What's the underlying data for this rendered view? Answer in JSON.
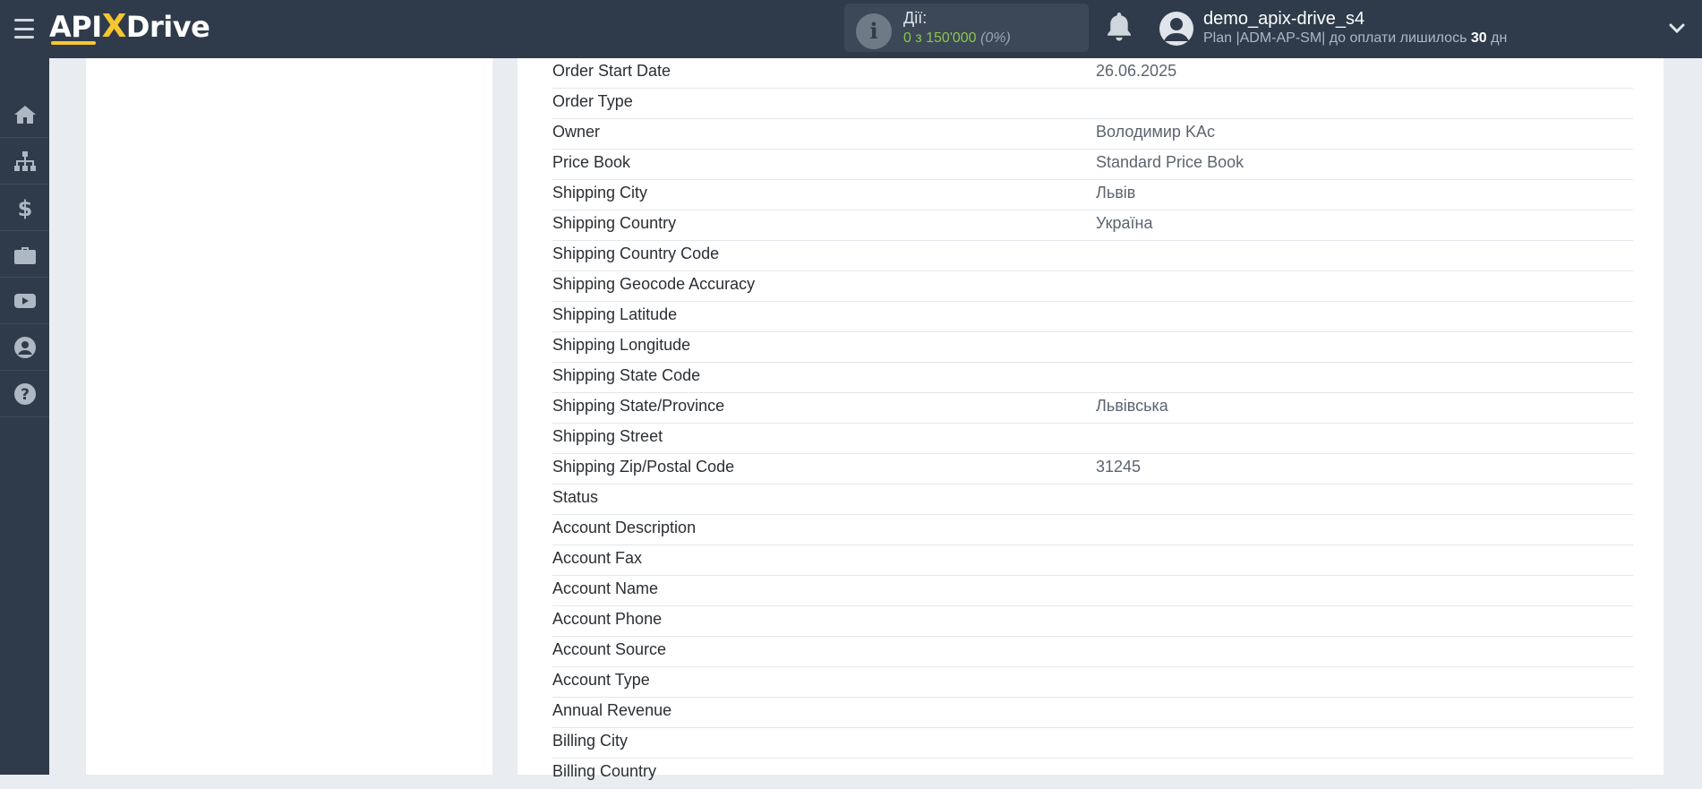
{
  "header": {
    "logo": {
      "left": "API",
      "x": "X",
      "right": "Drive"
    },
    "actions": {
      "label": "Дії:",
      "value": "0 з 150'000",
      "percent": "(0%)"
    },
    "user": {
      "name": "demo_apix-drive_s4",
      "plan_prefix": "Plan |ADM-AP-SM| до оплати лишилось",
      "days": "30",
      "days_unit": "дн"
    }
  },
  "sidebar": {
    "items": [
      {
        "icon": "home-icon"
      },
      {
        "icon": "sitemap-icon"
      },
      {
        "icon": "dollar-icon"
      },
      {
        "icon": "briefcase-icon"
      },
      {
        "icon": "youtube-icon"
      },
      {
        "icon": "user-circle-icon"
      },
      {
        "icon": "question-circle-icon"
      }
    ]
  },
  "fields": [
    {
      "key": "Order Start Date",
      "value": "26.06.2025"
    },
    {
      "key": "Order Type",
      "value": ""
    },
    {
      "key": "Owner",
      "value": "Володимир KAc"
    },
    {
      "key": "Price Book",
      "value": "Standard Price Book"
    },
    {
      "key": "Shipping City",
      "value": "Львів"
    },
    {
      "key": "Shipping Country",
      "value": "Україна"
    },
    {
      "key": "Shipping Country Code",
      "value": ""
    },
    {
      "key": "Shipping Geocode Accuracy",
      "value": ""
    },
    {
      "key": "Shipping Latitude",
      "value": ""
    },
    {
      "key": "Shipping Longitude",
      "value": ""
    },
    {
      "key": "Shipping State Code",
      "value": ""
    },
    {
      "key": "Shipping State/Province",
      "value": "Львівська"
    },
    {
      "key": "Shipping Street",
      "value": ""
    },
    {
      "key": "Shipping Zip/Postal Code",
      "value": "31245"
    },
    {
      "key": "Status",
      "value": ""
    },
    {
      "key": "Account Description",
      "value": ""
    },
    {
      "key": "Account Fax",
      "value": ""
    },
    {
      "key": "Account Name",
      "value": ""
    },
    {
      "key": "Account Phone",
      "value": ""
    },
    {
      "key": "Account Source",
      "value": ""
    },
    {
      "key": "Account Type",
      "value": ""
    },
    {
      "key": "Annual Revenue",
      "value": ""
    },
    {
      "key": "Billing City",
      "value": ""
    },
    {
      "key": "Billing Country",
      "value": ""
    }
  ]
}
